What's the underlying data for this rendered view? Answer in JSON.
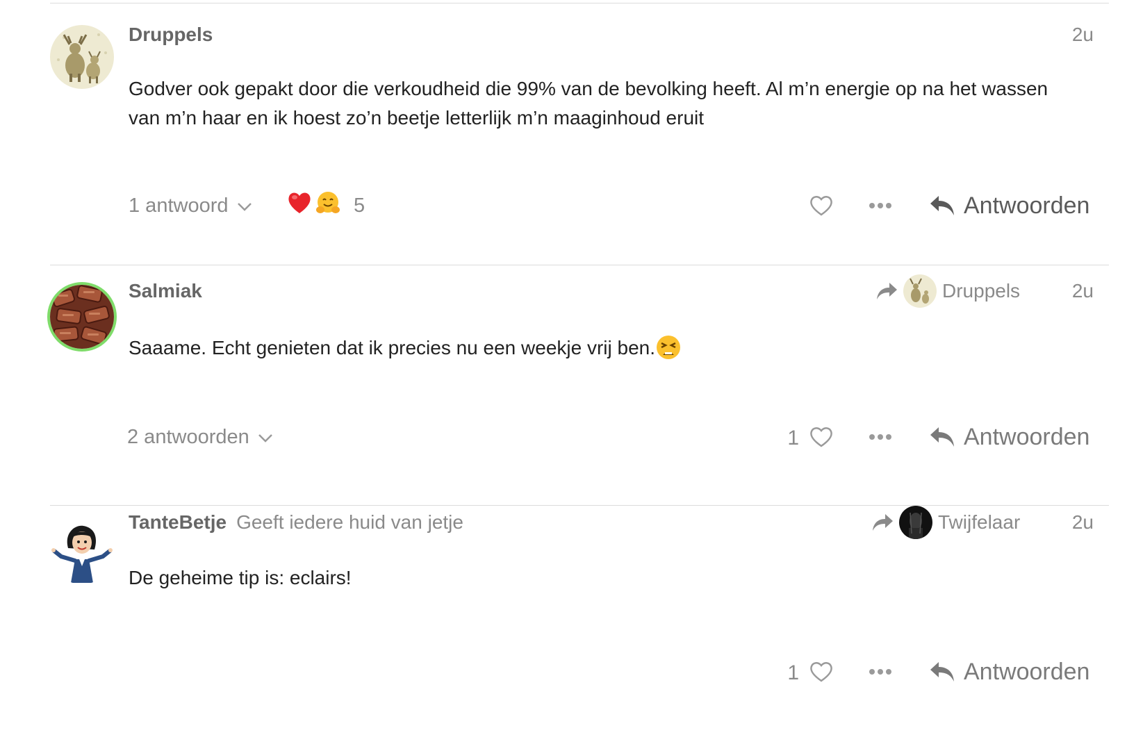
{
  "colors": {
    "accent_ring": "#7fdc6a",
    "muted_text": "#8a8a8a",
    "author_text": "#666666",
    "body_text": "#222222"
  },
  "posts": [
    {
      "avatar_icon": "moose-avatar",
      "author": "Druppels",
      "author_title": "",
      "time": "2u",
      "reply_to": null,
      "body": "Godver ook gepakt door die verkoudheid die 99% van de bevolking heeft. Al m’n energie op na het wassen van m’n haar en ik hoest zo’n beetje letterlijk m’n maaginhoud eruit",
      "replies_label": "1 antwoord",
      "reactions": [
        "heart-emoji",
        "hugging-emoji"
      ],
      "reaction_count": "5",
      "like_count": "",
      "reply_label": "Antwoorden"
    },
    {
      "avatar_icon": "salmiak-candy-avatar",
      "author": "Salmiak",
      "author_title": "",
      "time": "2u",
      "reply_to": {
        "name": "Druppels",
        "avatar_icon": "moose-avatar"
      },
      "body": "Saaame. Echt genieten dat ik precies nu een weekje vrij ben.",
      "body_emoji": "tired-face-emoji",
      "replies_label": "2 antwoorden",
      "reactions": [],
      "reaction_count": "",
      "like_count": "1",
      "reply_label": "Antwoorden"
    },
    {
      "avatar_icon": "cartoon-woman-avatar",
      "author": "TanteBetje",
      "author_title": "Geeft iedere huid van jetje",
      "time": "2u",
      "reply_to": {
        "name": "Twijfelaar",
        "avatar_icon": "dark-portrait-avatar"
      },
      "body": "De geheime tip is: eclairs!",
      "replies_label": "",
      "reactions": [],
      "reaction_count": "",
      "like_count": "1",
      "reply_label": "Antwoorden"
    }
  ]
}
